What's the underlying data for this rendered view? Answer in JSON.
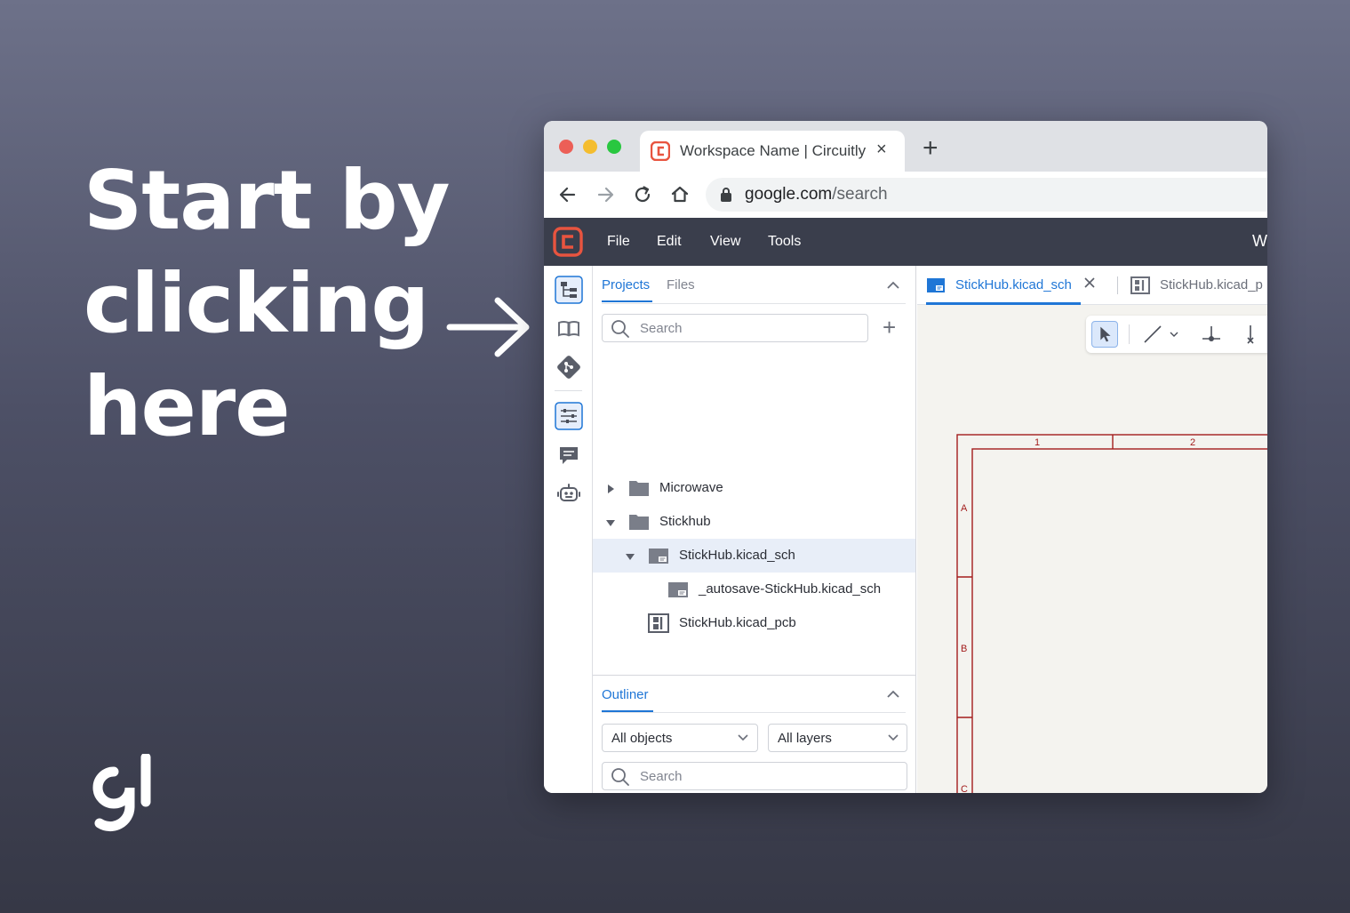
{
  "headline": [
    "Start by",
    "clicking",
    "here"
  ],
  "browser": {
    "tab_title": "Workspace Name | Circuitly",
    "url_host": "google.com",
    "url_path": "/search"
  },
  "app": {
    "menu": [
      "File",
      "Edit",
      "View",
      "Tools"
    ],
    "workspace_cut": "W",
    "accent": "#1f76d6",
    "brand": "#e8543f"
  },
  "panel": {
    "tabs": [
      "Projects",
      "Files"
    ],
    "search_placeholder": "Search",
    "tree": [
      {
        "label": "Microwave",
        "type": "folder",
        "expanded": false
      },
      {
        "label": "Stickhub",
        "type": "folder",
        "expanded": true
      },
      {
        "label": "StickHub.kicad_sch",
        "type": "schematic",
        "expanded": true,
        "selected": true
      },
      {
        "label": "_autosave-StickHub.kicad_sch",
        "type": "schematic"
      },
      {
        "label": "StickHub.kicad_pcb",
        "type": "pcb"
      }
    ]
  },
  "outliner": {
    "title": "Outliner",
    "objects_value": "All objects",
    "layers_value": "All layers",
    "search_placeholder": "Search"
  },
  "editor": {
    "tabs": [
      "StickHub.kicad_sch",
      "StickHub.kicad_p"
    ],
    "frame_columns": [
      "1",
      "2"
    ],
    "frame_rows": [
      "A",
      "B",
      "C"
    ]
  }
}
